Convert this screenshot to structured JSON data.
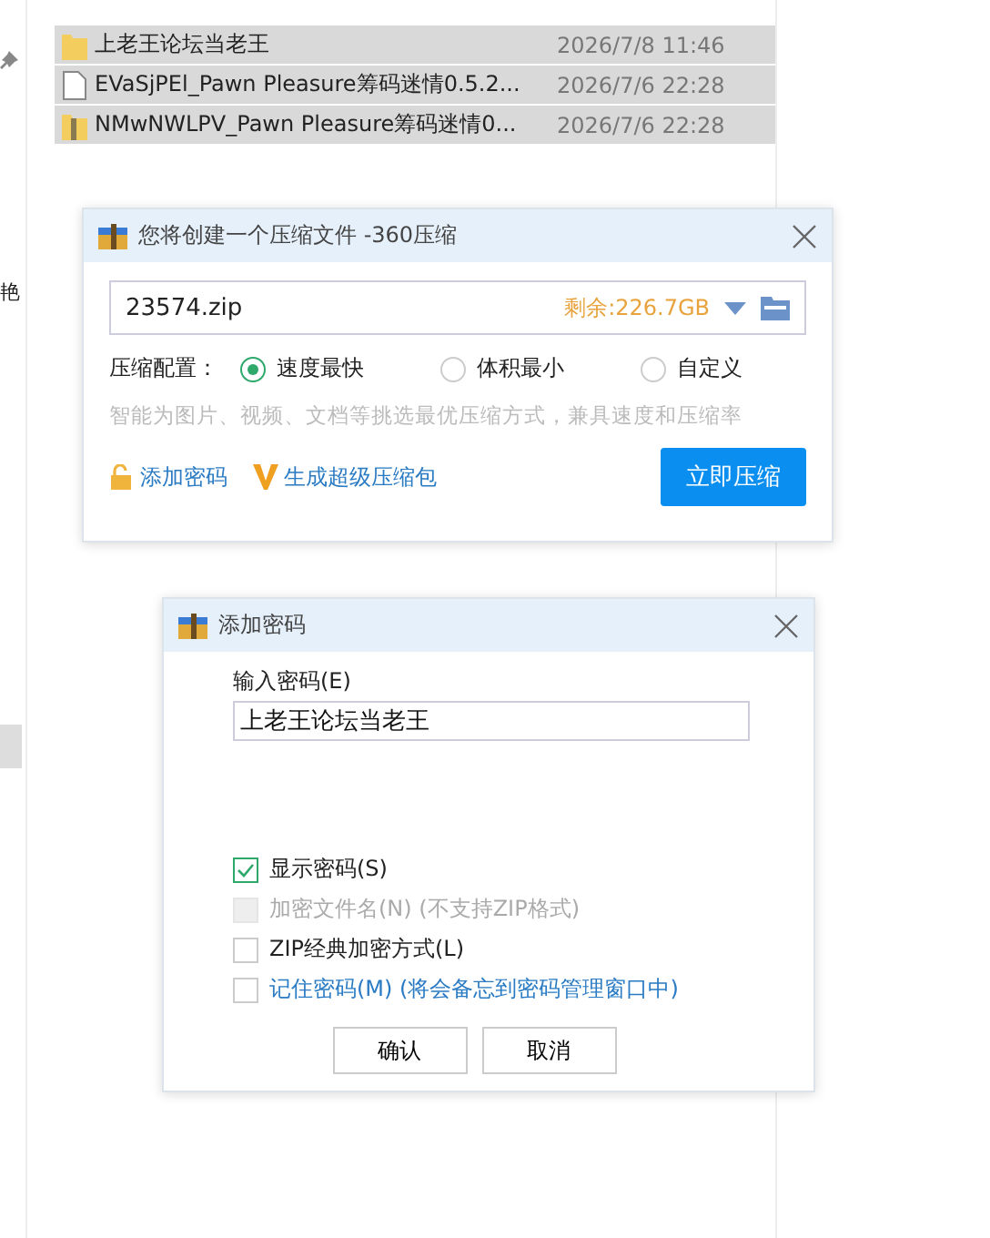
{
  "sidebar": {
    "glyph": "艳"
  },
  "files": [
    {
      "name": "上老王论坛当老王",
      "date": "2026/7/8 11:46",
      "kind": "folder",
      "selected": true
    },
    {
      "name": "EVaSjPEl_Pawn Pleasure筹码迷情0.5.2...",
      "date": "2026/7/6 22:28",
      "kind": "file",
      "selected": true
    },
    {
      "name": "NMwNWLPV_Pawn Pleasure筹码迷情0...",
      "date": "2026/7/6 22:28",
      "kind": "zip",
      "selected": true
    }
  ],
  "compress_dialog": {
    "title": "您将创建一个压缩文件 -360压缩",
    "filename": "23574.zip",
    "free_space": "剩余:226.7GB",
    "config_label": "压缩配置：",
    "options": [
      {
        "label": "速度最快",
        "selected": true
      },
      {
        "label": "体积最小",
        "selected": false
      },
      {
        "label": "自定义",
        "selected": false
      }
    ],
    "hint": "智能为图片、视频、文档等挑选最优压缩方式，兼具速度和压缩率",
    "add_password": "添加密码",
    "super_pack": "生成超级压缩包",
    "compress_button": "立即压缩"
  },
  "password_dialog": {
    "title": "添加密码",
    "field_label": "输入密码(E)",
    "password": "上老王论坛当老王",
    "options": [
      {
        "label": "显示密码(S)",
        "kind": "plain",
        "checked": true,
        "disabled": false
      },
      {
        "label": "加密文件名(N) (不支持ZIP格式)",
        "kind": "plain",
        "checked": false,
        "disabled": true
      },
      {
        "label": "ZIP经典加密方式(L)",
        "kind": "plain",
        "checked": false,
        "disabled": false
      },
      {
        "label": "记住密码(M) (将会备忘到密码管理窗口中)",
        "kind": "link",
        "checked": false,
        "disabled": false
      }
    ],
    "confirm": "确认",
    "cancel": "取消"
  }
}
